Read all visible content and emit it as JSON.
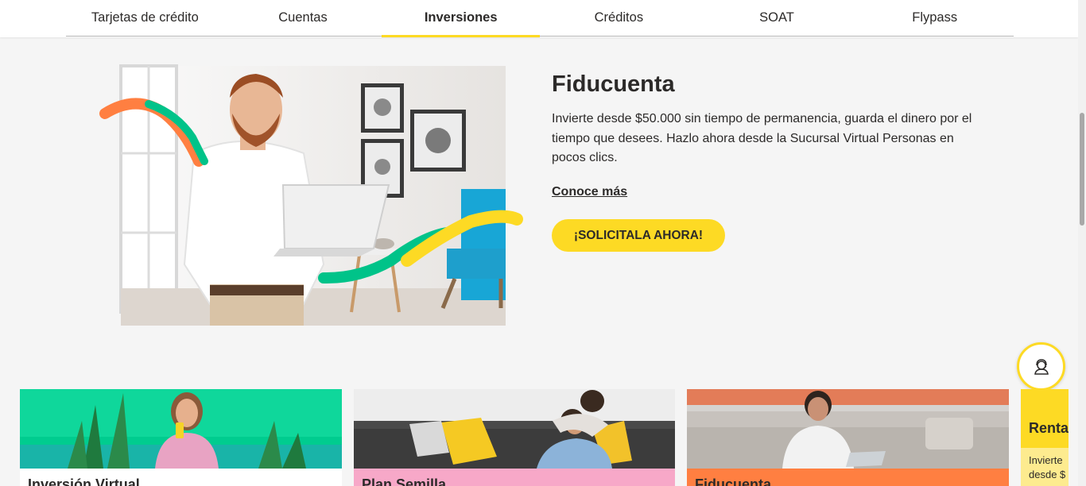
{
  "nav": {
    "tabs": [
      {
        "label": "Tarjetas de crédito"
      },
      {
        "label": "Cuentas"
      },
      {
        "label": "Inversiones"
      },
      {
        "label": "Créditos"
      },
      {
        "label": "SOAT"
      },
      {
        "label": "Flypass"
      }
    ],
    "active_tab": "Inversiones"
  },
  "hero": {
    "title": "Fiducuenta",
    "description": "Invierte desde $50.000 sin tiempo de permanencia, guarda el dinero por el tiempo que desees. Hazlo ahora desde la Sucursal Virtual Personas en pocos clics.",
    "link": "Conoce más",
    "cta": "¡SOLICITALA AHORA!"
  },
  "cards": [
    {
      "title": "Inversión Virtual",
      "band_color": "#ffffff"
    },
    {
      "title": "Plan Semilla",
      "band_color": "#f7a8c8"
    },
    {
      "title": "Fiducuenta",
      "band_color": "#ff7f41"
    }
  ],
  "partial_card": {
    "title": "Renta",
    "text_line1": "Invierte",
    "text_line2": "desde $"
  },
  "colors": {
    "brand_yellow": "#fdda24",
    "text": "#2c2a29",
    "accent_orange": "#ff7f41",
    "accent_green": "#00c389"
  },
  "icons": {
    "chat": "chat-agent-icon"
  }
}
